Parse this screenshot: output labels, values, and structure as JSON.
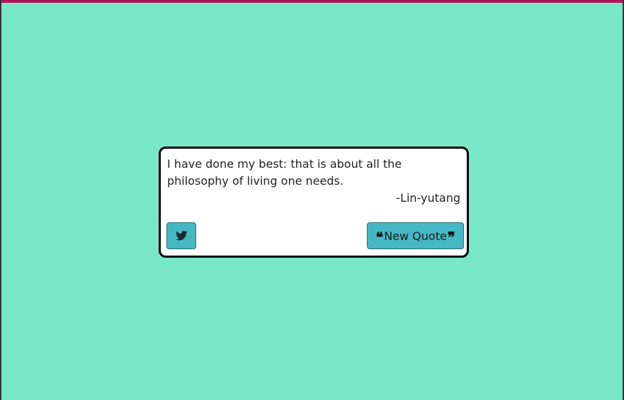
{
  "colors": {
    "background": "#79e8c7",
    "top_bar": "#b0155a",
    "button": "#45b8c3",
    "card": "#ffffff"
  },
  "quote": {
    "text": "I have done my best: that is about all the philosophy of living one needs.",
    "author": "-Lin-yutang"
  },
  "buttons": {
    "tweet_icon": "twitter-icon",
    "new_quote_label": "New Quote",
    "open_quote_icon": "open-quote-icon",
    "close_quote_icon": "close-quote-icon"
  }
}
